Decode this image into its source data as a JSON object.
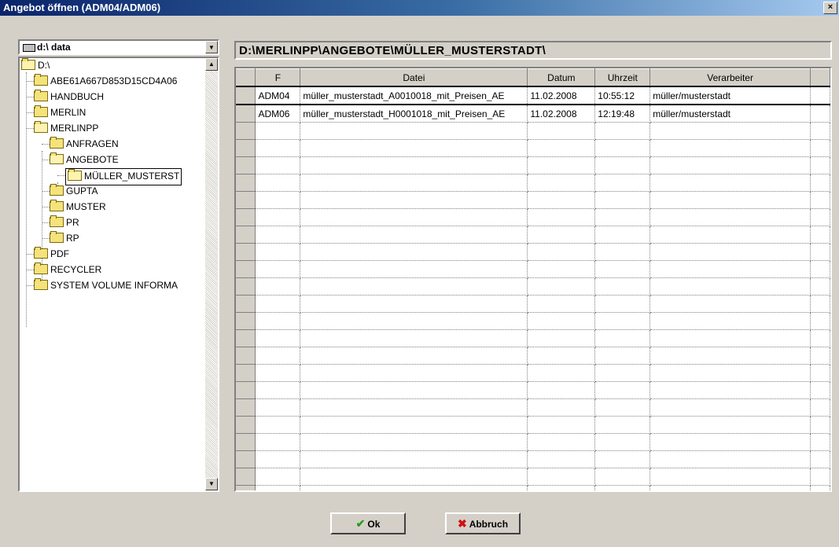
{
  "window": {
    "title": "Angebot öffnen (ADM04/ADM06)",
    "close_label": "×"
  },
  "drive": {
    "value": "d:\\ data"
  },
  "tree": {
    "items": [
      {
        "label": "D:\\",
        "level": 0
      },
      {
        "label": "ABE61A667D853D15CD4A06",
        "level": 1
      },
      {
        "label": "HANDBUCH",
        "level": 1
      },
      {
        "label": "MERLIN",
        "level": 1
      },
      {
        "label": "MERLINPP",
        "level": 1
      },
      {
        "label": "ANFRAGEN",
        "level": 2
      },
      {
        "label": "ANGEBOTE",
        "level": 2
      },
      {
        "label": "MÜLLER_MUSTERST",
        "level": 3
      },
      {
        "label": "GUPTA",
        "level": 2
      },
      {
        "label": "MUSTER",
        "level": 2
      },
      {
        "label": "PR",
        "level": 2
      },
      {
        "label": "RP",
        "level": 2
      },
      {
        "label": "PDF",
        "level": 1
      },
      {
        "label": "RECYCLER",
        "level": 1
      },
      {
        "label": "SYSTEM VOLUME INFORMA",
        "level": 1
      }
    ]
  },
  "path": "D:\\MERLINPP\\ANGEBOTE\\MÜLLER_MUSTERSTADT\\",
  "grid": {
    "columns": [
      "F",
      "Datei",
      "Datum",
      "Uhrzeit",
      "Verarbeiter"
    ],
    "rows": [
      {
        "f": "ADM04",
        "datei": "müller_musterstadt_A0010018_mit_Preisen_AE",
        "datum": "11.02.2008",
        "uhrzeit": "10:55:12",
        "verarbeiter": "müller/musterstadt"
      },
      {
        "f": "ADM06",
        "datei": "müller_musterstadt_H0001018_mit_Preisen_AE",
        "datum": "11.02.2008",
        "uhrzeit": "12:19:48",
        "verarbeiter": "müller/musterstadt"
      }
    ]
  },
  "buttons": {
    "ok": "Ok",
    "cancel": "Abbruch"
  },
  "colors": {
    "titlebar": "#0a246a",
    "ok_icon": "#2a9a1a",
    "cancel_icon": "#d01010"
  }
}
